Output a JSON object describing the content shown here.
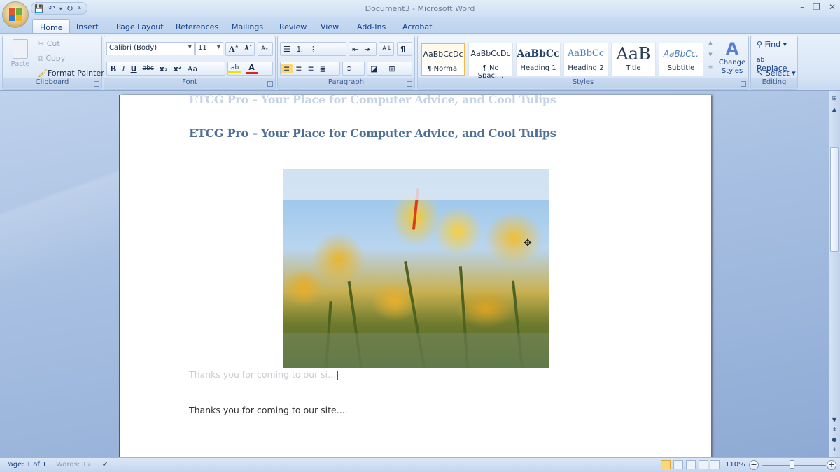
{
  "window": {
    "title": "Document3 - Microsoft Word",
    "controls": {
      "minimize": "–",
      "restore": "❐",
      "close": "✕"
    }
  },
  "quick_access": {
    "save_icon": "💾",
    "undo_icon": "↶",
    "undo_dropdown": "▾",
    "redo_icon": "↻",
    "customize_icon": "⩡"
  },
  "tabs": [
    {
      "label": "Home",
      "active": true
    },
    {
      "label": "Insert"
    },
    {
      "label": "Page Layout"
    },
    {
      "label": "References"
    },
    {
      "label": "Mailings"
    },
    {
      "label": "Review"
    },
    {
      "label": "View"
    },
    {
      "label": "Add-Ins"
    },
    {
      "label": "Acrobat"
    }
  ],
  "help_icon": "?",
  "ribbon": {
    "clipboard": {
      "label": "Clipboard",
      "paste": "Paste",
      "cut": "Cut",
      "copy": "Copy",
      "format_painter": "Format Painter"
    },
    "font": {
      "label": "Font",
      "font_name": "Calibri (Body)",
      "font_size": "11",
      "grow": "A˄",
      "shrink": "A˅",
      "clear": "Aₓ",
      "bold": "B",
      "italic": "I",
      "underline": "U",
      "strikethrough": "abc",
      "subscript": "x₂",
      "superscript": "x²",
      "change_case": "Aa",
      "highlight": "ab",
      "font_color": "A",
      "highlight_color": "#f5e100",
      "font_color_value": "#e02020"
    },
    "paragraph": {
      "label": "Paragraph",
      "bullets": "☰",
      "numbering": "⒈",
      "multilevel": "⋮",
      "decrease_indent": "⇤",
      "increase_indent": "⇥",
      "sort": "A↓",
      "show_marks": "¶",
      "align_left": "≡",
      "center": "≡",
      "align_right": "≡",
      "justify": "≣",
      "line_spacing": "↕",
      "shading": "◪",
      "borders": "⊞"
    },
    "styles": {
      "label": "Styles",
      "items": [
        {
          "preview": "AaBbCcDc",
          "name": "¶ Normal",
          "active": true
        },
        {
          "preview": "AaBbCcDc",
          "name": "¶ No Spaci..."
        },
        {
          "preview": "AaBbCc",
          "name": "Heading 1"
        },
        {
          "preview": "AaBbCc",
          "name": "Heading 2"
        },
        {
          "preview": "AaB",
          "name": "Title"
        },
        {
          "preview": "AaBbCc.",
          "name": "Subtitle"
        }
      ],
      "change_styles": "Change Styles"
    },
    "editing": {
      "label": "Editing",
      "find": "Find",
      "replace": "Replace",
      "select": "Select"
    }
  },
  "document": {
    "heading_ghost": "ETCG Pro – Your Place for Computer Advice, and Cool Tulips",
    "heading": "ETCG Pro – Your Place for Computer Advice, and Cool Tulips",
    "image_alt": "Yellow tulips against blue sky",
    "body_ghost": "Thanks you for coming to our si...",
    "body": "Thanks you for coming to our site...."
  },
  "statusbar": {
    "page": "Page: 1 of 1",
    "words": "Words: 17",
    "proofing_icon": "✔",
    "zoom": "110%",
    "zoom_level_percent": 110,
    "zoom_out": "−",
    "zoom_in": "+"
  },
  "scrollbar": {
    "ruler_toggle": "⊞",
    "up": "▲",
    "down": "▼",
    "prev_page": "⇞",
    "browse_object": "●",
    "next_page": "⇟"
  }
}
